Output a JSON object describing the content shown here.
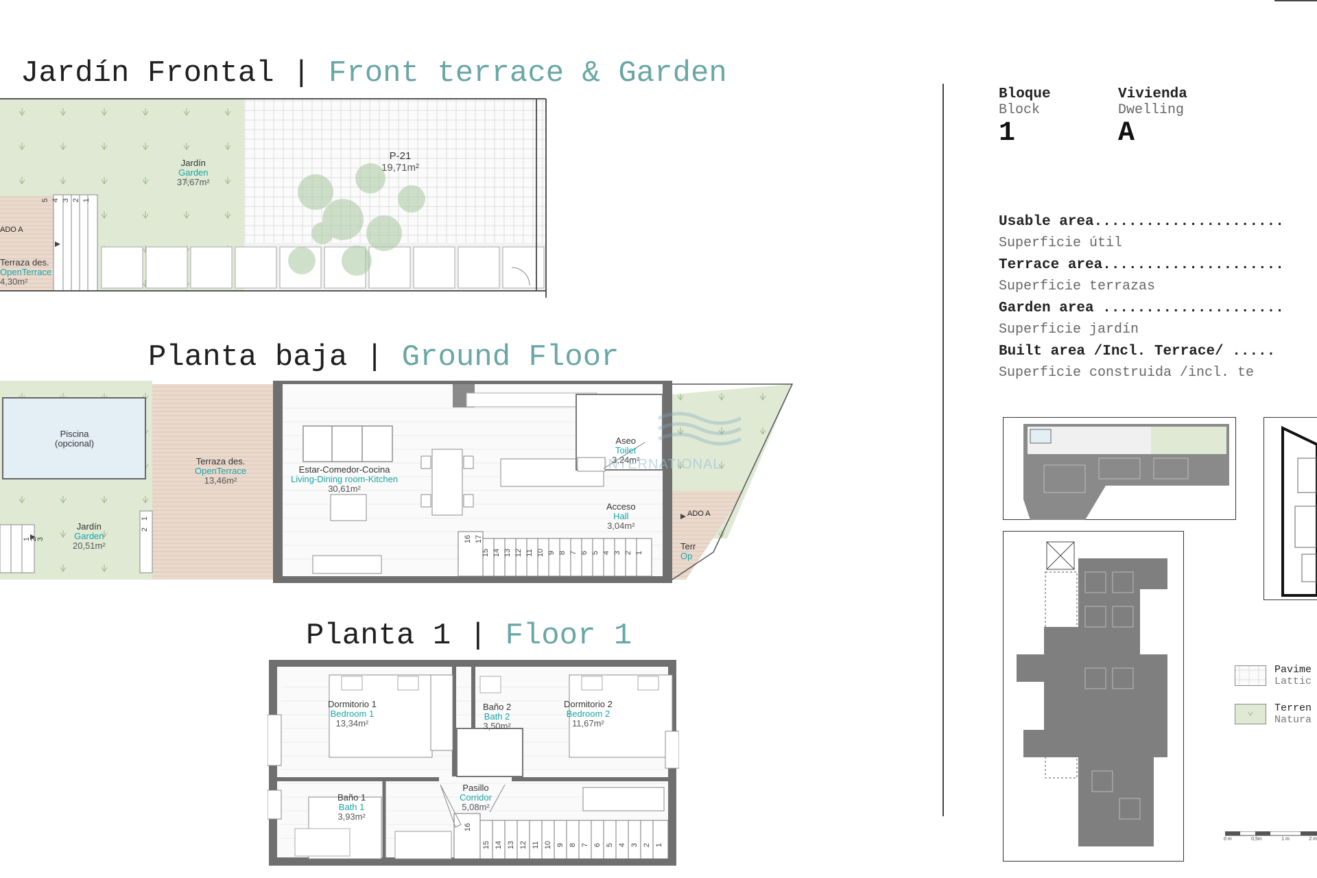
{
  "titles": {
    "front": {
      "es": "Jardín Frontal",
      "sep": "|",
      "en": "Front terrace & Garden"
    },
    "ground": {
      "es": "Planta baja",
      "sep": "|",
      "en": "Ground Floor"
    },
    "floor1": {
      "es": "Planta 1",
      "sep": "|",
      "en": "Floor 1"
    }
  },
  "front_rooms": {
    "garden": {
      "es": "Jardín",
      "en": "Garden",
      "area": "37,67m²"
    },
    "p21": {
      "es": "P-21",
      "area": "19,71m²"
    },
    "terrace": {
      "es": "Terraza des.",
      "en": "OpenTerrace",
      "area": "4,30m²"
    },
    "acceso": "ADO A",
    "steps": [
      "5",
      "4",
      "3",
      "2",
      "1"
    ]
  },
  "ground_rooms": {
    "pool": {
      "es": "Piscina",
      "en": "(opcional)"
    },
    "terrace": {
      "es": "Terraza des.",
      "en": "OpenTerrace",
      "area": "13,46m²"
    },
    "garden": {
      "es": "Jardín",
      "en": "Garden",
      "area": "20,51m²"
    },
    "living": {
      "es": "Estar-Comedor-Cocina",
      "en": "Living-Dining room-Kitchen",
      "area": "30,61m²"
    },
    "toilet": {
      "es": "Aseo",
      "en": "Toilet",
      "area": "3,24m²"
    },
    "hall": {
      "es": "Acceso",
      "en": "Hall",
      "area": "3,04m²"
    },
    "acceso": "ADO A",
    "terr_cut": {
      "es": "Terr",
      "en": "Op"
    },
    "stairs": [
      "15",
      "14",
      "13",
      "12",
      "11",
      "10",
      "9",
      "8",
      "7",
      "6",
      "5",
      "4",
      "3",
      "2",
      "1"
    ],
    "stairs_top": [
      "16",
      "17"
    ],
    "garden_steps": [
      "1",
      "2",
      "3"
    ],
    "side_steps": [
      "1",
      "2"
    ]
  },
  "floor1_rooms": {
    "bed1": {
      "es": "Dormitorio 1",
      "en": "Bedroom 1",
      "area": "13,34m²"
    },
    "bath2": {
      "es": "Baño 2",
      "en": "Bath 2",
      "area": "3,50m²"
    },
    "bed2": {
      "es": "Dormitorio 2",
      "en": "Bedroom 2",
      "area": "11,67m²"
    },
    "bath1": {
      "es": "Baño 1",
      "en": "Bath 1",
      "area": "3,93m²"
    },
    "corridor": {
      "es": "Pasillo",
      "en": "Corridor",
      "area": "5,08m²"
    },
    "stairs": [
      "15",
      "14",
      "13",
      "12",
      "11",
      "10",
      "9",
      "8",
      "7",
      "6",
      "5",
      "4",
      "3",
      "2",
      "1"
    ],
    "stairs_top": [
      "16"
    ]
  },
  "watermark": "INTERNATIONAL",
  "info": {
    "block_h": "Bloque",
    "block_s": "Block",
    "block_v": "1",
    "dwelling_h": "Vivienda",
    "dwelling_s": "Dwelling",
    "dwelling_v": "A",
    "rows": [
      {
        "en": "Usable area......................",
        "es": "Superficie útil"
      },
      {
        "en": "Terrace area.....................",
        "es": "Superficie terrazas"
      },
      {
        "en": "Garden area .....................",
        "es": "Superficie jardín"
      },
      {
        "en": "Built area /Incl. Terrace/ .....",
        "es": "Superficie construida /incl. te"
      }
    ]
  },
  "legend": [
    {
      "es": "Pavime",
      "en": "Lattic",
      "swatch": "lattice"
    },
    {
      "es": "Terren",
      "en": "Natura",
      "swatch": "green"
    }
  ],
  "scale": [
    "0 m",
    "0,5m",
    "1 m",
    "2 m"
  ],
  "colors": {
    "accent": "#6aa6a6",
    "label_teal": "#19a5a8",
    "garden_green": "#dfe9d4",
    "terrace_wood": "#ead9cd",
    "pool_blue": "#e3eff5",
    "wall": "#8a8a8a",
    "context_gray": "#7f7f7f"
  }
}
